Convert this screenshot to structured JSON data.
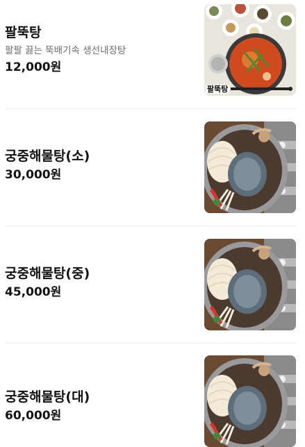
{
  "menu": {
    "items": [
      {
        "name": "팔뚝탕",
        "description": "팔팔 끓는 뚝배기속 생선내장탕",
        "price": "12,000원",
        "image": "spicy-fish-stew-photo",
        "image_caption": "팔뚝탕"
      },
      {
        "name": "궁중해물탕(소)",
        "price": "30,000원",
        "image": "seafood-hotpot-photo"
      },
      {
        "name": "궁중해물탕(중)",
        "price": "45,000원",
        "image": "seafood-hotpot-photo"
      },
      {
        "name": "궁중해물탕(대)",
        "price": "60,000원",
        "image": "seafood-hotpot-photo"
      }
    ]
  }
}
